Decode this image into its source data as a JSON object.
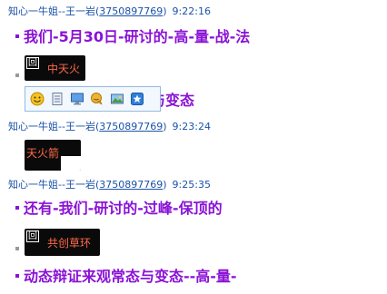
{
  "messages": [
    {
      "sender": "知心一牛姐--王一岩",
      "qq": "3750897769",
      "time": "9:22:16",
      "lines": [
        "我们-5月30日-研讨的-高-量-战-法"
      ],
      "thumb": {
        "tag": "回",
        "text": "中天火"
      },
      "line2": "态与变态"
    },
    {
      "sender": "知心一牛姐--王一岩",
      "qq": "3750897769",
      "time": "9:23:24",
      "thumb": {
        "text": "天火箭"
      }
    },
    {
      "sender": "知心一牛姐--王一岩",
      "qq": "3750897769",
      "time": "9:25:35",
      "lines": [
        "还有-我们-研讨的-过峰-保顶的",
        "动态辩证来观常态与变态--高-量-"
      ],
      "thumb": {
        "tag": "回",
        "text": "共创草环"
      }
    }
  ],
  "toolbar": {
    "buttons": [
      "smiley-icon",
      "document-icon",
      "monitor-icon",
      "chat-icon",
      "image-icon",
      "star-bookmark-icon"
    ]
  },
  "colors": {
    "header": "#1a52a8",
    "message_text": "#8a12d6",
    "thumb_bg": "#0a0a0a",
    "thumb_text": "#ff6a4a",
    "toolbar_bg": "#f2f8fe",
    "toolbar_border": "#96b9df"
  }
}
